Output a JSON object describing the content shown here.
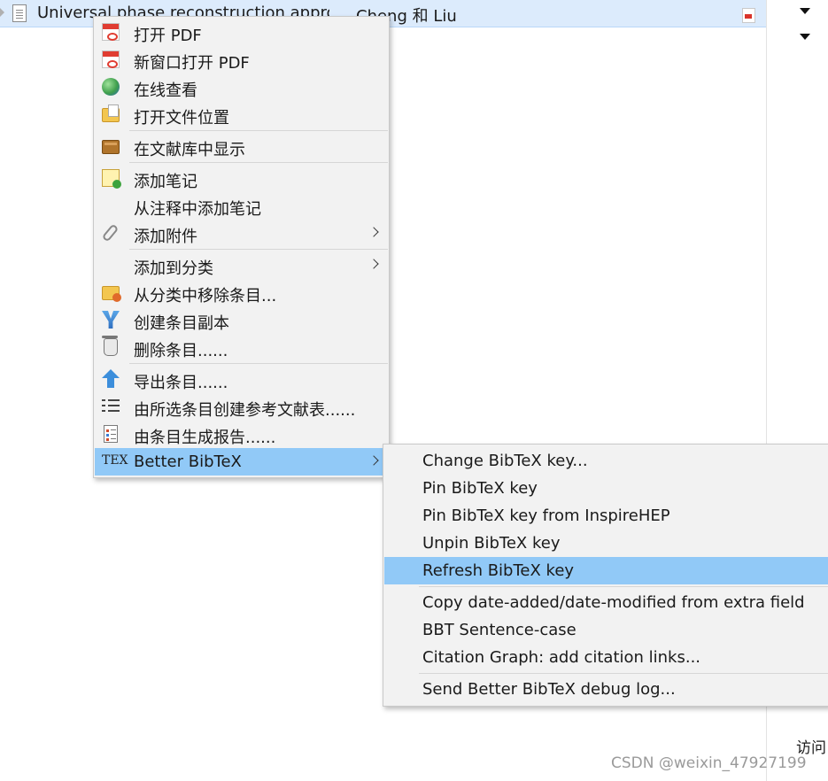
{
  "item_row": {
    "title": "Universal phase reconstruction appro...",
    "creator": "Cheng 和 Liu"
  },
  "context_menu": {
    "items": [
      {
        "label": "打开 PDF",
        "icon": "pdf-icon"
      },
      {
        "label": "新窗口打开 PDF",
        "icon": "pdf-icon"
      },
      {
        "label": "在线查看",
        "icon": "globe-icon"
      },
      {
        "label": "打开文件位置",
        "icon": "folder-icon"
      },
      {
        "label": "在文献库中显示",
        "icon": "library-icon"
      },
      {
        "label": "添加笔记",
        "icon": "add-note-icon"
      },
      {
        "label": "从注释中添加笔记",
        "icon": ""
      },
      {
        "label": "添加附件",
        "icon": "paperclip-icon",
        "submenu": true
      },
      {
        "label": "添加到分类",
        "icon": "",
        "submenu": true
      },
      {
        "label": "从分类中移除条目...",
        "icon": "folder-remove-icon"
      },
      {
        "label": "创建条目副本",
        "icon": "duplicate-icon"
      },
      {
        "label": "删除条目......",
        "icon": "trash-icon"
      },
      {
        "label": "导出条目......",
        "icon": "export-icon"
      },
      {
        "label": "由所选条目创建参考文献表......",
        "icon": "bibliography-icon"
      },
      {
        "label": "由条目生成报告......",
        "icon": "report-icon"
      },
      {
        "label": "Better BibTeX",
        "icon": "tex-icon",
        "submenu": true,
        "highlighted": true
      }
    ],
    "tex_logo": "TEX"
  },
  "submenu": {
    "items": [
      {
        "label": "Change BibTeX key..."
      },
      {
        "label": "Pin BibTeX key"
      },
      {
        "label": "Pin BibTeX key from InspireHEP"
      },
      {
        "label": "Unpin BibTeX key"
      },
      {
        "label": "Refresh BibTeX key",
        "highlighted": true
      },
      {
        "label": "Copy date-added/date-modified from extra field"
      },
      {
        "label": "BBT Sentence-case"
      },
      {
        "label": "Citation Graph: add citation links..."
      },
      {
        "label": "Send Better BibTeX debug log..."
      }
    ]
  },
  "bottom_label": "访问",
  "watermark": "CSDN @weixin_47927199",
  "colors": {
    "highlight": "#91c9f7",
    "menu_bg": "#f2f2f2",
    "row_selected": "#dcebfc"
  }
}
